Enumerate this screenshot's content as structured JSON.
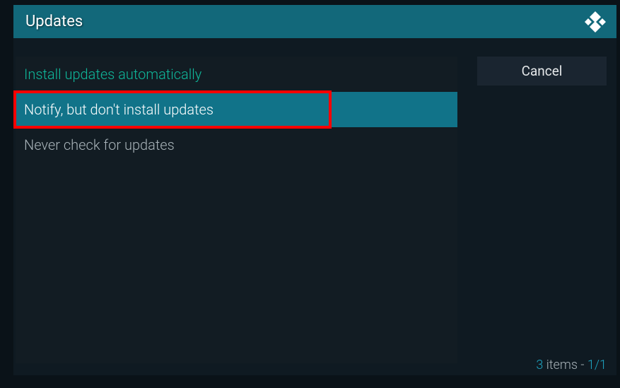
{
  "header": {
    "title": "Updates"
  },
  "options": [
    {
      "label": "Install updates automatically",
      "state": "current"
    },
    {
      "label": "Notify, but don't install updates",
      "state": "selected"
    },
    {
      "label": "Never check for updates",
      "state": "normal"
    }
  ],
  "cancel": {
    "label": "Cancel"
  },
  "status": {
    "count": "3",
    "items_label": " items - ",
    "page": "1/1"
  }
}
